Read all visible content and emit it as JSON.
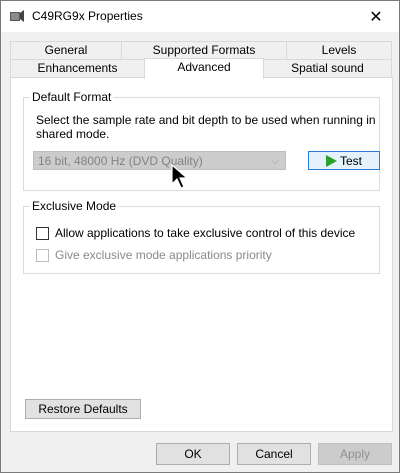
{
  "window": {
    "title": "C49RG9x Properties",
    "close_glyph": "✕",
    "icon": "speaker-icon"
  },
  "tabs_top": [
    "General",
    "Supported Formats",
    "Levels"
  ],
  "tabs_bottom": [
    "Enhancements",
    "Advanced",
    "Spatial sound"
  ],
  "active_tab": "Advanced",
  "default_format": {
    "title": "Default Format",
    "description": "Select the sample rate and bit depth to be used when running in shared mode.",
    "selected": "16 bit, 48000 Hz (DVD Quality)",
    "chevron": "⌵",
    "test_label": "Test"
  },
  "exclusive_mode": {
    "title": "Exclusive Mode",
    "allow_label": "Allow applications to take exclusive control of this device",
    "priority_label": "Give exclusive mode applications priority"
  },
  "restore_label": "Restore Defaults",
  "buttons": {
    "ok": "OK",
    "cancel": "Cancel",
    "apply": "Apply"
  },
  "colors": {
    "accent_border": "#2b7bd8",
    "play_green": "#2aa12a"
  }
}
